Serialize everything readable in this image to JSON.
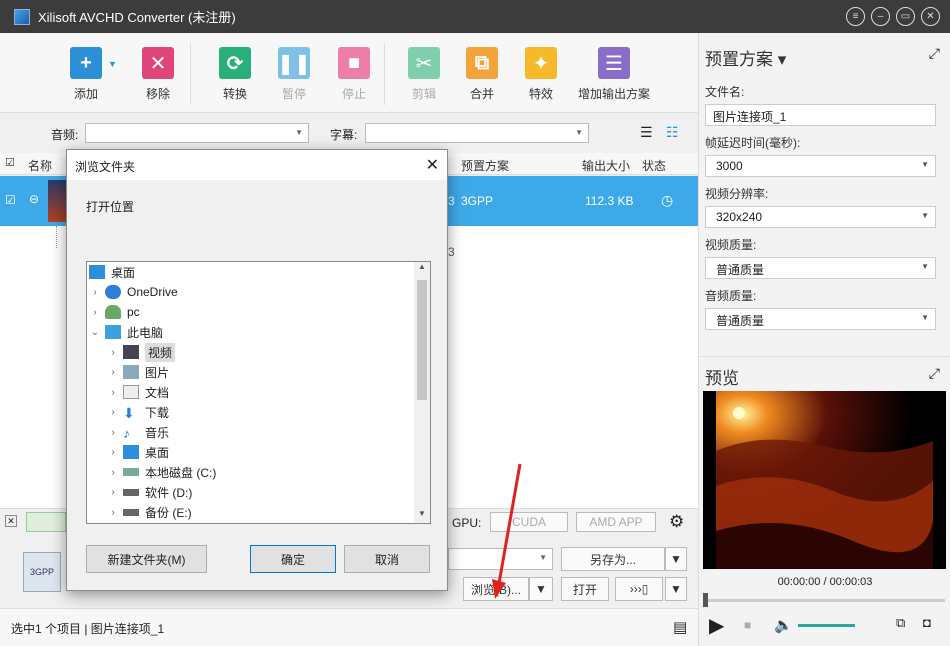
{
  "window": {
    "title": "Xilisoft AVCHD Converter (未注册)"
  },
  "toolbar": {
    "add": "添加",
    "remove": "移除",
    "convert": "转换",
    "pause": "暂停",
    "stop": "停止",
    "clip": "剪辑",
    "merge": "合并",
    "effect": "特效",
    "add_profile": "增加输出方案"
  },
  "filter": {
    "audio_label": "音频:",
    "subtitle_label": "字幕:"
  },
  "list": {
    "headers": {
      "name": "名称",
      "profile": "预置方案",
      "size": "输出大小",
      "status": "状态"
    },
    "row": {
      "num": "3",
      "profile": "3GPP",
      "size": "112.3 KB"
    },
    "sub_num": "3"
  },
  "right": {
    "profile_title": "预置方案",
    "file_name_label": "文件名:",
    "file_name_value": "图片连接项_1",
    "frame_delay_label": "帧延迟时间(毫秒):",
    "frame_delay_value": "3000",
    "resolution_label": "视频分辨率:",
    "resolution_value": "320x240",
    "video_quality_label": "视频质量:",
    "video_quality_value": "普通质量",
    "audio_quality_label": "音频质量:",
    "audio_quality_value": "普通质量",
    "preview_title": "预览",
    "time": "00:00:00 / 00:00:03"
  },
  "bottom": {
    "gpu": "GPU:",
    "cuda": "CUDA",
    "amd": "AMD APP",
    "save_as": "另存为...",
    "browse": "浏览(B)...",
    "open": "打开",
    "profile_badge": "3GPP"
  },
  "status": {
    "text": "选中1 个项目 | 图片连接项_1"
  },
  "dialog": {
    "title": "浏览文件夹",
    "subtitle": "打开位置",
    "new_folder": "新建文件夹(M)",
    "ok": "确定",
    "cancel": "取消",
    "tree": [
      "桌面",
      "OneDrive",
      "pc",
      "此电脑",
      "视频",
      "图片",
      "文档",
      "下载",
      "音乐",
      "桌面",
      "本地磁盘 (C:)",
      "软件 (D:)",
      "备份 (E:)"
    ]
  },
  "colors": {
    "accent": "#3ea9e8",
    "titlebar": "#3c3c3c"
  }
}
